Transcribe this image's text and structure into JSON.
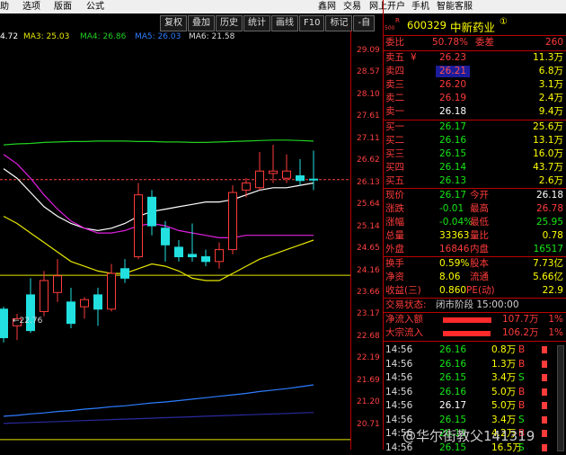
{
  "menu": {
    "items": [
      "助",
      "选项",
      "版面",
      "公式"
    ],
    "right_items": [
      "鑫网",
      "交易",
      "网上开户",
      "手机",
      "智能客服"
    ]
  },
  "toolbar": {
    "buttons": [
      "复权",
      "叠加",
      "历史",
      "统计",
      "画线",
      "F10",
      "标记",
      "-自"
    ]
  },
  "ma": {
    "ma1": "4.72",
    "ma3": "MA3: 25.03",
    "ma4": "MA4: 26.86",
    "ma5": "MA5: 26.03",
    "ma6": "MA6: 21.58"
  },
  "price_axis": [
    "29.09",
    "28.57",
    "28.10",
    "27.61",
    "27.11",
    "26.62",
    "26.13",
    "25.64",
    "25.14",
    "24.65",
    "24.16",
    "23.66",
    "23.17",
    "22.68",
    "22.19",
    "21.69",
    "21.20",
    "20.71"
  ],
  "annotation": "←22.76",
  "stock": {
    "r_mark": "R",
    "code": "600329",
    "name": "中新药业",
    "info_icon": "①",
    "small_num": "500"
  },
  "weibi": {
    "label": "委比",
    "pct": "50.78%",
    "label2": "委差",
    "value": "260"
  },
  "asks": [
    {
      "label": "卖五",
      "flag": "¥",
      "price": "26.23",
      "vol": "11.3万"
    },
    {
      "label": "卖四",
      "flag": "",
      "price": "26.21",
      "vol": "6.8万"
    },
    {
      "label": "卖三",
      "flag": "",
      "price": "26.20",
      "vol": "3.1万"
    },
    {
      "label": "卖二",
      "flag": "",
      "price": "26.19",
      "vol": "2.4万"
    },
    {
      "label": "卖一",
      "flag": "",
      "price": "26.18",
      "vol": "9.4万"
    }
  ],
  "bids": [
    {
      "label": "买一",
      "price": "26.17",
      "vol": "25.6万"
    },
    {
      "label": "买二",
      "price": "26.16",
      "vol": "13.1万"
    },
    {
      "label": "买三",
      "price": "26.15",
      "vol": "16.0万"
    },
    {
      "label": "买四",
      "price": "26.14",
      "vol": "43.7万"
    },
    {
      "label": "买五",
      "price": "26.13",
      "vol": "2.6万"
    }
  ],
  "quote": [
    {
      "l1": "现价",
      "v1": "26.17",
      "l2": "今开",
      "v2": "26.18"
    },
    {
      "l1": "涨跌",
      "v1": "-0.01",
      "l2": "最高",
      "v2": "26.78"
    },
    {
      "l1": "涨幅",
      "v1": "-0.04%",
      "l2": "最低",
      "v2": "25.95"
    },
    {
      "l1": "总量",
      "v1": "33363",
      "l2": "量比",
      "v2": "0.78"
    },
    {
      "l1": "外盘",
      "v1": "16846",
      "l2": "内盘",
      "v2": "16517"
    }
  ],
  "stats": [
    {
      "l1": "换手",
      "v1": "0.59%",
      "l2": "股本",
      "v2": "7.73亿"
    },
    {
      "l1": "净资",
      "v1": "8.06",
      "l2": "流通",
      "v2": "5.66亿"
    },
    {
      "l1": "收益(三)",
      "v1": "0.860",
      "l2": "PE(动)",
      "v2": "22.9"
    }
  ],
  "status": {
    "label": "交易状态:",
    "value": "闭市阶段 15:00:00"
  },
  "flows": [
    {
      "label": "净流入额",
      "value": "107.7万",
      "pct": "1%",
      "bar_pct": 85
    },
    {
      "label": "大宗流入",
      "value": "106.2万",
      "pct": "1%",
      "bar_pct": 83
    }
  ],
  "trades": [
    {
      "time": "14:56",
      "price": "26.16",
      "vol": "0.8万",
      "side": "B"
    },
    {
      "time": "14:56",
      "price": "26.16",
      "vol": "1.3万",
      "side": "B"
    },
    {
      "time": "14:56",
      "price": "26.15",
      "vol": "3.4万",
      "side": "S"
    },
    {
      "time": "14:56",
      "price": "26.16",
      "vol": "5.0万",
      "side": "B"
    },
    {
      "time": "14:56",
      "price": "26.17",
      "vol": "5.0万",
      "side": "B"
    },
    {
      "time": "14:56",
      "price": "26.15",
      "vol": "3.4万",
      "side": "S"
    },
    {
      "time": "14:56",
      "price": "26.11",
      "vol": "4.2万",
      "side": "B"
    },
    {
      "time": "14:56",
      "price": "26.15",
      "vol": "16.5万",
      "side": "S"
    }
  ],
  "watermark": "@华尔街教父141319",
  "colors": {
    "up": "#ff3b3b",
    "down": "#17e617",
    "even": "#ffffff",
    "label": "#ff3b3b"
  },
  "chart_data": {
    "type": "candlestick",
    "ylim": [
      20.5,
      29.3
    ],
    "candles": [
      {
        "o": 23.45,
        "c": 22.85,
        "h": 23.5,
        "l": 22.75
      },
      {
        "o": 23.1,
        "c": 23.25,
        "h": 23.35,
        "l": 22.8
      },
      {
        "o": 23.75,
        "c": 23.0,
        "h": 24.1,
        "l": 22.95
      },
      {
        "o": 23.4,
        "c": 24.05,
        "h": 24.25,
        "l": 23.3
      },
      {
        "o": 23.8,
        "c": 24.15,
        "h": 24.5,
        "l": 23.6
      },
      {
        "o": 23.6,
        "c": 23.15,
        "h": 23.9,
        "l": 23.05
      },
      {
        "o": 23.5,
        "c": 23.65,
        "h": 23.7,
        "l": 23.25
      },
      {
        "o": 23.75,
        "c": 23.45,
        "h": 23.9,
        "l": 23.1
      },
      {
        "o": 23.45,
        "c": 24.2,
        "h": 24.4,
        "l": 23.4
      },
      {
        "o": 24.3,
        "c": 24.1,
        "h": 24.5,
        "l": 24.0
      },
      {
        "o": 24.55,
        "c": 25.85,
        "h": 26.1,
        "l": 24.5
      },
      {
        "o": 25.8,
        "c": 25.2,
        "h": 25.95,
        "l": 25.0
      },
      {
        "o": 25.15,
        "c": 24.8,
        "h": 25.3,
        "l": 24.45
      },
      {
        "o": 24.75,
        "c": 24.55,
        "h": 24.9,
        "l": 24.45
      },
      {
        "o": 24.6,
        "c": 24.55,
        "h": 25.25,
        "l": 24.45
      },
      {
        "o": 24.55,
        "c": 24.45,
        "h": 24.7,
        "l": 24.35
      },
      {
        "o": 24.45,
        "c": 24.7,
        "h": 24.85,
        "l": 24.3
      },
      {
        "o": 24.7,
        "c": 25.9,
        "h": 26.05,
        "l": 24.6
      },
      {
        "o": 25.95,
        "c": 26.1,
        "h": 26.2,
        "l": 25.8
      },
      {
        "o": 26.0,
        "c": 26.35,
        "h": 26.75,
        "l": 25.95
      },
      {
        "o": 26.3,
        "c": 26.35,
        "h": 26.9,
        "l": 26.1
      },
      {
        "o": 26.2,
        "c": 26.35,
        "h": 26.7,
        "l": 26.1
      },
      {
        "o": 26.25,
        "c": 26.15,
        "h": 26.6,
        "l": 26.05
      },
      {
        "o": 26.18,
        "c": 26.17,
        "h": 26.78,
        "l": 25.95
      }
    ],
    "lines": [
      {
        "color": "#ffffff",
        "values": [
          26.4,
          26.2,
          25.9,
          25.6,
          25.4,
          25.25,
          25.15,
          25.1,
          25.15,
          25.25,
          25.4,
          25.5,
          25.55,
          25.6,
          25.65,
          25.7,
          25.7,
          25.75,
          25.85,
          25.95,
          26.0,
          26.0,
          26.05,
          26.1
        ]
      },
      {
        "color": "#e020e0",
        "values": [
          26.7,
          26.5,
          26.2,
          25.85,
          25.55,
          25.3,
          25.15,
          25.05,
          25.05,
          25.1,
          25.2,
          25.25,
          25.2,
          25.1,
          25.05,
          25.0,
          24.95,
          24.95,
          25.0,
          25.0,
          25.0,
          25.0,
          25.0,
          25.0
        ]
      },
      {
        "color": "#e6e600",
        "values": [
          25.4,
          25.25,
          25.05,
          24.85,
          24.65,
          24.45,
          24.35,
          24.25,
          24.2,
          24.2,
          24.3,
          24.4,
          24.35,
          24.25,
          24.1,
          24.05,
          24.05,
          24.2,
          24.35,
          24.5,
          24.6,
          24.7,
          24.8,
          24.9
        ]
      },
      {
        "color": "#2d7dff",
        "values": [
          21.2,
          21.22,
          21.25,
          21.27,
          21.3,
          21.32,
          21.35,
          21.37,
          21.4,
          21.42,
          21.45,
          21.48,
          21.5,
          21.53,
          21.56,
          21.59,
          21.62,
          21.65,
          21.68,
          21.72,
          21.75,
          21.78,
          21.82,
          21.86
        ]
      },
      {
        "color": "#20d020",
        "values": [
          26.9,
          26.92,
          26.93,
          26.95,
          26.96,
          26.97,
          26.97,
          26.98,
          26.98,
          26.98,
          26.97,
          26.97,
          26.96,
          26.96,
          26.95,
          26.95,
          26.96,
          26.97,
          26.98,
          26.99,
          27.0,
          27.0,
          26.99,
          26.98
        ]
      },
      {
        "color": "#2a2aa0",
        "values": [
          21.05,
          21.06,
          21.07,
          21.08,
          21.09,
          21.1,
          21.11,
          21.12,
          21.13,
          21.14,
          21.15,
          21.16,
          21.17,
          21.18,
          21.19,
          21.2,
          21.21,
          21.22,
          21.23,
          21.24,
          21.25,
          21.26,
          21.27,
          21.28
        ]
      }
    ],
    "hlines": [
      {
        "value": 24.16,
        "color": "#e6e600"
      },
      {
        "value": 20.71,
        "color": "#e6e600"
      },
      {
        "value": 26.17,
        "color": "#ff4040",
        "dashed": true
      }
    ]
  }
}
